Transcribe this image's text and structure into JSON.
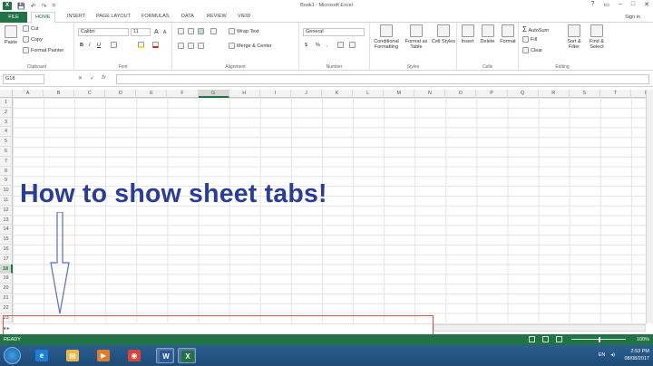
{
  "window": {
    "title": "Book1 - Microsoft Excel",
    "controls": [
      "?",
      "▭",
      "–",
      "□",
      "✕"
    ]
  },
  "qat": {
    "app_icon": "X",
    "save": "💾",
    "undo": "↶",
    "redo": "↷",
    "more": "="
  },
  "ribbon_tabs": [
    "FILE",
    "HOME",
    "INSERT",
    "PAGE LAYOUT",
    "FORMULAS",
    "DATA",
    "REVIEW",
    "VIEW"
  ],
  "active_tab": "HOME",
  "signin": "Sign in",
  "ribbon": {
    "clipboard": {
      "label": "Clipboard",
      "paste": "Paste",
      "cut": "Cut",
      "copy": "Copy",
      "format_painter": "Format Painter"
    },
    "font": {
      "label": "Font",
      "font_name": "Calibri",
      "font_size": "11",
      "grow": "A",
      "shrink": "A",
      "bold": "B",
      "italic": "I",
      "underline": "U"
    },
    "alignment": {
      "label": "Alignment",
      "wrap_text": "Wrap Text",
      "merge_center": "Merge & Center"
    },
    "number": {
      "label": "Number",
      "format": "General",
      "currency": "$",
      "percent": "%",
      "comma": ","
    },
    "styles": {
      "label": "Styles",
      "conditional": "Conditional Formatting",
      "format_table": "Format as Table",
      "cell_styles": "Cell Styles"
    },
    "cells": {
      "label": "Cells",
      "insert": "Insert",
      "delete": "Delete",
      "format": "Format"
    },
    "editing": {
      "label": "Editing",
      "autosum": "AutoSum",
      "fill": "Fill",
      "clear": "Clear",
      "sort_filter": "Sort & Filter",
      "find_select": "Find & Select"
    }
  },
  "formula_bar": {
    "name_box": "G18",
    "cancel": "✕",
    "enter": "✓",
    "fx": "fx",
    "value": ""
  },
  "columns": [
    "A",
    "B",
    "C",
    "D",
    "E",
    "F",
    "G",
    "H",
    "I",
    "J",
    "K",
    "L",
    "M",
    "N",
    "O",
    "P",
    "Q",
    "R",
    "S",
    "T",
    "U"
  ],
  "selected_column": "G",
  "rows": [
    "1",
    "2",
    "3",
    "4",
    "5",
    "6",
    "7",
    "8",
    "9",
    "10",
    "11",
    "12",
    "13",
    "14",
    "15",
    "16",
    "17",
    "18",
    "19",
    "20",
    "21",
    "22",
    "23"
  ],
  "selected_row": "18",
  "overlay": {
    "headline": "How to show sheet tabs!"
  },
  "status": {
    "ready": "READY",
    "zoom": "100%"
  },
  "taskbar": {
    "tray_lang": "EN",
    "time": "2:53 PM",
    "date": "08/08/2017",
    "apps": [
      {
        "name": "ie-icon",
        "glyph": "e",
        "color": "#1c7fd6"
      },
      {
        "name": "explorer-icon",
        "glyph": "▤",
        "color": "#e8b84a"
      },
      {
        "name": "media-player-icon",
        "glyph": "▶",
        "color": "#e07b2a"
      },
      {
        "name": "chrome-icon",
        "glyph": "◉",
        "color": "#d9443a"
      },
      {
        "name": "word-icon",
        "glyph": "W",
        "color": "#2b579a"
      },
      {
        "name": "excel-icon",
        "glyph": "X",
        "color": "#217346"
      }
    ]
  },
  "colors": {
    "excel_green": "#217346",
    "headline": "#2a3d99",
    "highlight_box": "#d9534f"
  }
}
